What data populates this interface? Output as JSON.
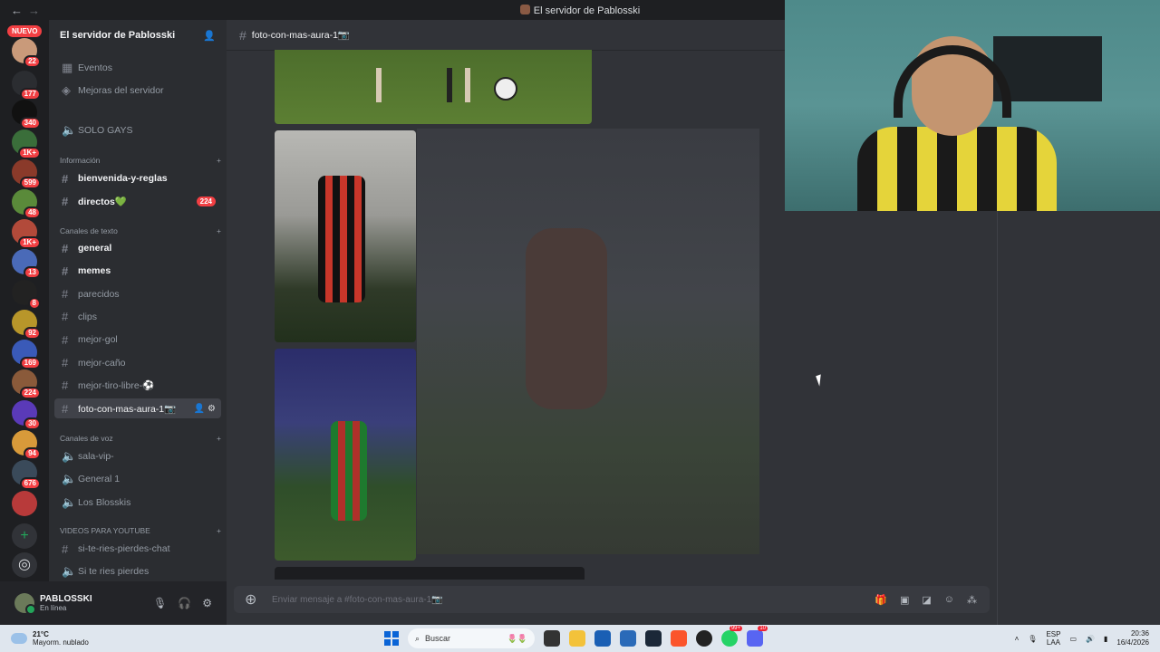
{
  "titlebar": {
    "title": "El servidor de Pablosski",
    "back": "←",
    "forward": "→"
  },
  "servers": {
    "nuevo": "NUEVO",
    "items": [
      {
        "badge": "22",
        "color": "#c99a7a"
      },
      {
        "badge": "177",
        "color": "#2b2d31"
      },
      {
        "badge": "340",
        "color": "#111111"
      },
      {
        "badge": "1K+",
        "color": "#3a6e3a"
      },
      {
        "badge": "599",
        "color": "#8a3a2a"
      },
      {
        "badge": "48",
        "color": "#5a8a3a"
      },
      {
        "badge": "1K+",
        "color": "#b24a3a"
      },
      {
        "badge": "13",
        "color": "#4a6ab8"
      },
      {
        "badge": "8",
        "color": "#222222"
      },
      {
        "badge": "92",
        "color": "#b8962a"
      },
      {
        "badge": "169",
        "color": "#3a5ab8"
      },
      {
        "badge": "224",
        "color": "#8a5a3a"
      },
      {
        "badge": "30",
        "color": "#5a3ab8"
      },
      {
        "badge": "94",
        "color": "#d89a3a"
      },
      {
        "badge": "676",
        "color": "#3a4a5a"
      },
      {
        "badge": "",
        "color": "#b83a3a"
      }
    ],
    "add_label": "+",
    "discover_label": "◎"
  },
  "sidebar": {
    "server_name": "El servidor de Pablosski",
    "top_items": [
      {
        "label": "Eventos",
        "icon": "calendar-icon"
      },
      {
        "label": "Mejoras del servidor",
        "icon": "boost-icon"
      }
    ],
    "solo": "SOLO GAYS",
    "categories": {
      "info": "Información",
      "text": "Canales de texto",
      "voice": "Canales de voz",
      "youtube": "VIDEOS PARA YOUTUBE"
    },
    "info_channels": [
      {
        "label": "bienvenida-y-reglas",
        "unread": true
      },
      {
        "label": "directos💚",
        "unread": true,
        "count": "224"
      }
    ],
    "text_channels": [
      {
        "label": "general",
        "unread": true
      },
      {
        "label": "memes",
        "unread": true
      },
      {
        "label": "parecidos"
      },
      {
        "label": "clips"
      },
      {
        "label": "mejor-gol"
      },
      {
        "label": "mejor-caño"
      },
      {
        "label": "mejor-tiro-libre-⚽"
      },
      {
        "label": "foto-con-mas-aura-1📷",
        "active": true
      }
    ],
    "voice_channels": [
      {
        "label": "sala-vip-"
      },
      {
        "label": "General 1"
      },
      {
        "label": "Los Blosskis"
      }
    ],
    "youtube_channels": [
      {
        "label": "si-te-ries-pierdes-chat",
        "type": "text"
      },
      {
        "label": "Si te ries pierdes",
        "type": "voice"
      }
    ]
  },
  "user": {
    "name": "PABLOSSKI",
    "status": "En línea"
  },
  "channel": {
    "name": "foto-con-mas-aura-1📷",
    "composer_placeholder": "Enviar mensaje a #foto-con-mas-aura-1📷"
  },
  "taskbar": {
    "temp": "21°C",
    "weather": "Mayorm. nublado",
    "search": "Buscar",
    "lang1": "ESP",
    "lang2": "LAA",
    "time": "20:36",
    "date": "16/4/2026",
    "badge_whatsapp": "99+",
    "badge_discord": "10"
  }
}
